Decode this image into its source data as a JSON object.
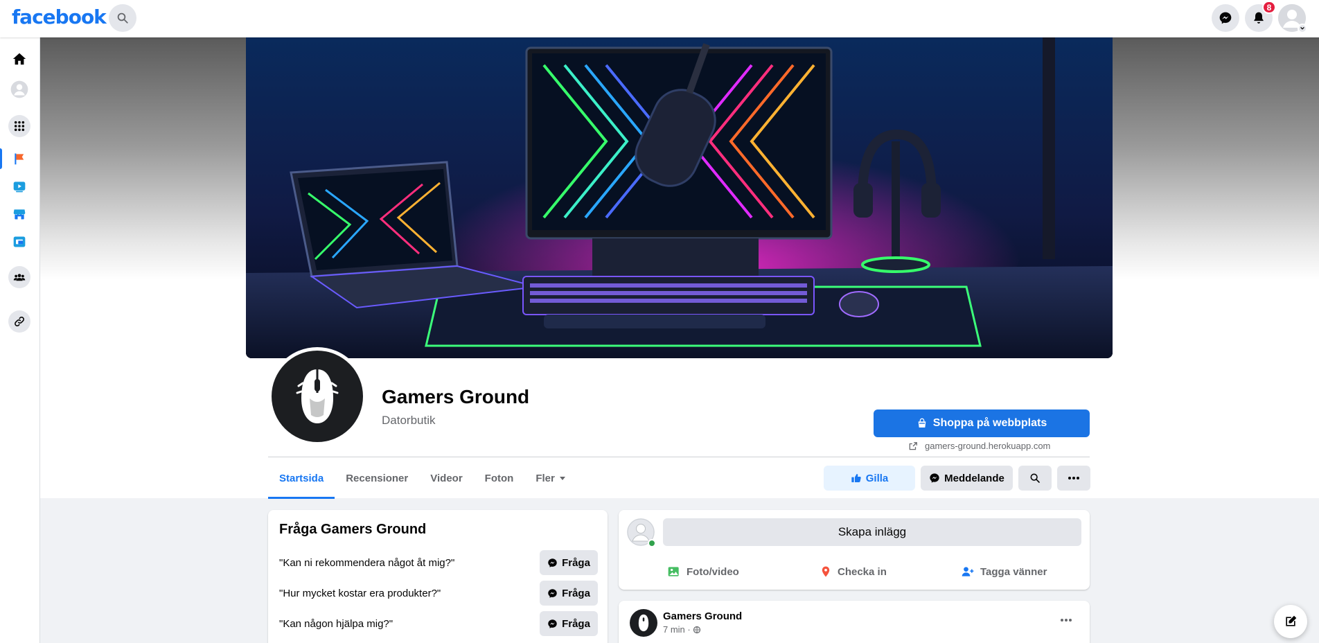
{
  "brand": {
    "logo": "facebook",
    "color": "#1877f2"
  },
  "topbar": {
    "icons": [
      "search-icon",
      "messenger-icon",
      "bell-icon",
      "avatar"
    ],
    "notifications_count": "8"
  },
  "rail": {
    "items": [
      "home-icon",
      "profile-icon",
      "apps-grid-icon",
      "pages-flag-icon",
      "watch-icon",
      "marketplace-icon",
      "gaming-icon",
      "groups-icon",
      "link-icon"
    ]
  },
  "page": {
    "name": "Gamers Ground",
    "category": "Datorbutik"
  },
  "shop": {
    "label": "Shoppa på webbplats",
    "url": "gamers-ground.herokuapp.com"
  },
  "tabs": [
    {
      "label": "Startsida",
      "active": true
    },
    {
      "label": "Recensioner"
    },
    {
      "label": "Videor"
    },
    {
      "label": "Foton"
    },
    {
      "label": "Fler"
    }
  ],
  "actions": {
    "like": "Gilla",
    "message": "Meddelande"
  },
  "ask": {
    "title": "Fråga Gamers Ground",
    "button_label": "Fråga",
    "questions": [
      "\"Kan ni rekommendera något åt mig?\"",
      "\"Hur mycket kostar era produkter?\"",
      "\"Kan någon hjälpa mig?\""
    ]
  },
  "composer": {
    "placeholder": "Skapa inlägg",
    "photo": "Foto/video",
    "checkin": "Checka in",
    "tag": "Tagga vänner"
  },
  "post": {
    "author": "Gamers Ground",
    "time": "7 min ·"
  }
}
